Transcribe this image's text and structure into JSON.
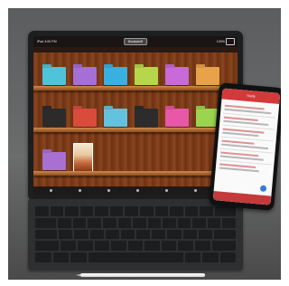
{
  "scene": {
    "tablet": {
      "status_left": "iPad 3:00 PM",
      "status_right": "100%",
      "header_title": "Bookshelf",
      "shelves": [
        {
          "folders": [
            "#4fc3d9",
            "#a56fd6",
            "#3ab0e0",
            "#b6d64b",
            "#c86ad7",
            "#e8a24a"
          ]
        },
        {
          "folders": [
            "#2b2b2b",
            "#d94c3c",
            "#63c3df",
            "#2c2c2c",
            "#e857a8",
            "#9bd54f"
          ]
        },
        {
          "folders": [
            "#a770d1"
          ],
          "book": true
        }
      ]
    },
    "phone": {
      "header_title": "Study"
    },
    "colors": {
      "wood": "#7a3a18",
      "phone_accent": "#d23a3a"
    }
  }
}
